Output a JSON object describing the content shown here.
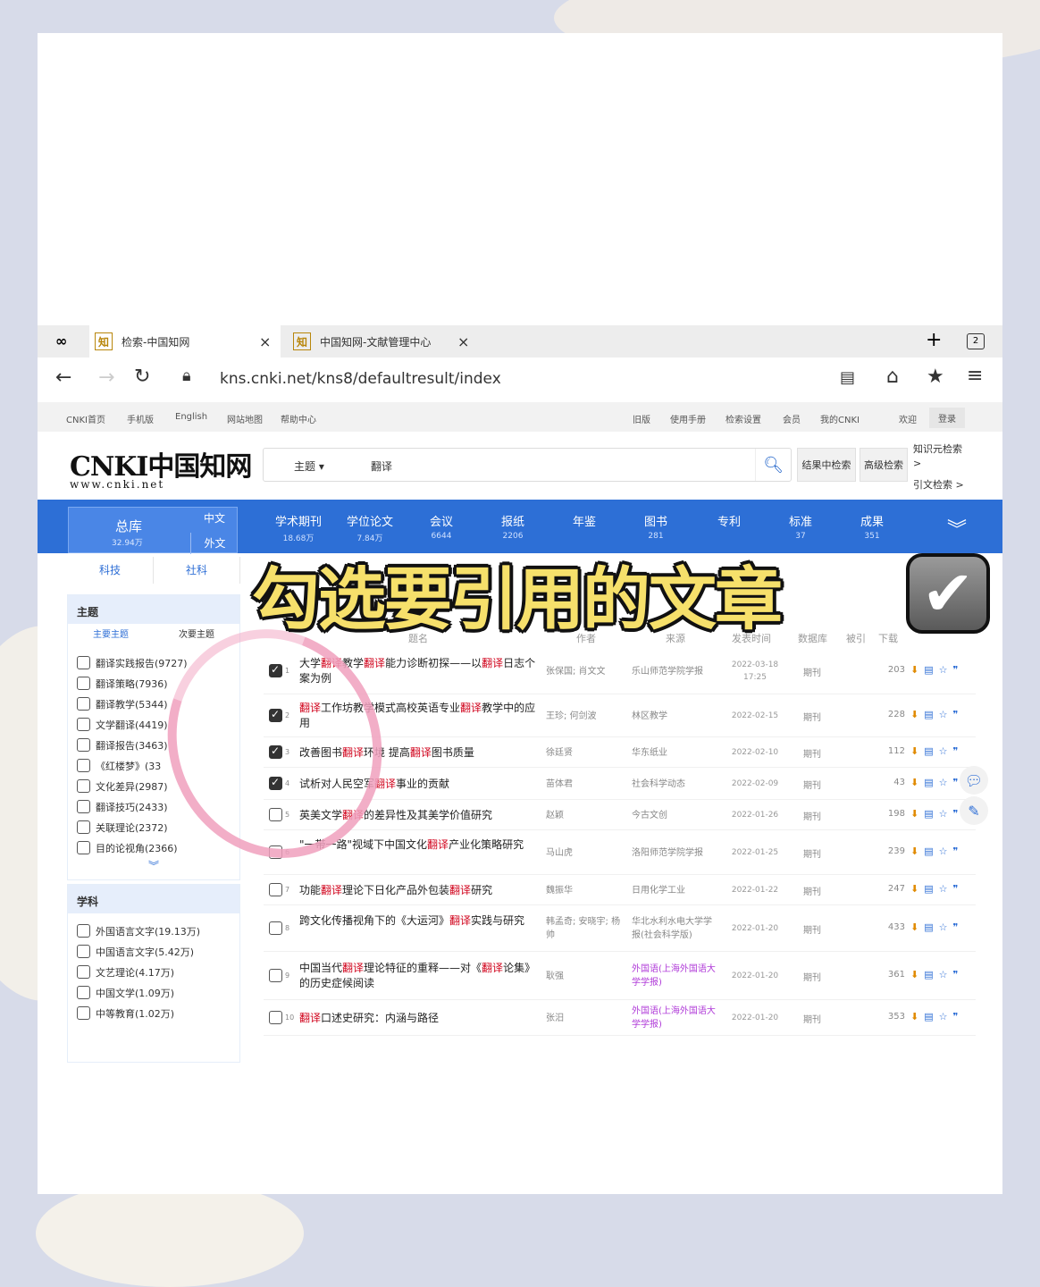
{
  "browser": {
    "tabs": [
      {
        "favicon": "知",
        "title": "检索-中国知网"
      },
      {
        "favicon": "知",
        "title": "中国知网-文献管理中心"
      }
    ],
    "tab_count": "2",
    "url": "kns.cnki.net/kns8/defaultresult/index"
  },
  "topnav": {
    "left": [
      "CNKI首页",
      "手机版",
      "English",
      "网站地图",
      "帮助中心"
    ],
    "right": [
      "旧版",
      "使用手册",
      "检索设置",
      "会员",
      "我的CNKI",
      "欢迎",
      "登录"
    ]
  },
  "header": {
    "logo_main": "CNKI中国知网",
    "logo_sub": "www.cnki.net",
    "search_field": "主题",
    "search_keyword": "翻译",
    "btn_in_results": "结果中检索",
    "btn_advanced": "高级检索",
    "link_knowledge": "知识元检索 >",
    "link_citation": "引文检索 >"
  },
  "databases": {
    "zongku": {
      "name": "总库",
      "count": "32.94万",
      "zh": "中文",
      "wai": "外文"
    },
    "tabs": [
      {
        "name": "学术期刊",
        "count": "18.68万"
      },
      {
        "name": "学位论文",
        "count": "7.84万"
      },
      {
        "name": "会议",
        "count": "6644"
      },
      {
        "name": "报纸",
        "count": "2206"
      },
      {
        "name": "年鉴",
        "count": ""
      },
      {
        "name": "图书",
        "count": "281"
      },
      {
        "name": "专利",
        "count": ""
      },
      {
        "name": "标准",
        "count": "37"
      },
      {
        "name": "成果",
        "count": "351"
      }
    ]
  },
  "left": {
    "subtabs": [
      "科技",
      "社科"
    ],
    "topic": {
      "title": "主题",
      "sub": [
        "主要主题",
        "次要主题"
      ],
      "items": [
        "翻译实践报告(9727)",
        "翻译策略(7936)",
        "翻译教学(5344)",
        "文学翻译(4419)",
        "翻译报告(3463)",
        "《红楼梦》(33",
        "文化差异(2987)",
        "翻译技巧(2433)",
        "关联理论(2372)",
        "目的论视角(2366)"
      ]
    },
    "subject": {
      "title": "学科",
      "items": [
        "外国语言文字(19.13万)",
        "中国语言文字(5.42万)",
        "文艺理论(4.17万)",
        "中国文学(1.09万)",
        "中等教育(1.02万)"
      ]
    }
  },
  "table": {
    "headers": [
      "题名",
      "作者",
      "来源",
      "发表时间",
      "数据库",
      "被引",
      "下载"
    ],
    "rows": [
      {
        "num": "1",
        "checked": true,
        "title_parts": [
          "大学",
          "翻译",
          "教学",
          "翻译",
          "能力诊断初探——以",
          "翻译",
          "日志个案为例"
        ],
        "author": "张保国; 肖文文",
        "source": "乐山师范学院学报",
        "date": "2022-03-18 17:25",
        "db": "期刊",
        "downloads": "203"
      },
      {
        "num": "2",
        "checked": true,
        "title_parts": [
          "",
          "翻译",
          "工作坊教学模式",
          "",
          "高校英语专业",
          "翻译",
          "教学中的应用"
        ],
        "author": "王珍; 何剑波",
        "source": "林区教学",
        "date": "2022-02-15",
        "db": "期刊",
        "downloads": "228"
      },
      {
        "num": "3",
        "checked": true,
        "title_parts": [
          "改善图书",
          "翻译",
          "环境 提高",
          "翻译",
          "图书质量",
          "",
          ""
        ],
        "author": "徐廷贤",
        "source": "华东纸业",
        "date": "2022-02-10",
        "db": "期刊",
        "downloads": "112"
      },
      {
        "num": "4",
        "checked": true,
        "title_parts": [
          "试析",
          "",
          "对人民空军",
          "翻译",
          "事业的贡献",
          "",
          ""
        ],
        "author": "苗体君",
        "source": "社会科学动态",
        "date": "2022-02-09",
        "db": "期刊",
        "downloads": "43"
      },
      {
        "num": "5",
        "checked": false,
        "title_parts": [
          "英美文学",
          "翻译",
          "的差异性及其美学价值研究",
          "",
          "",
          "",
          ""
        ],
        "author": "赵颖",
        "source": "今古文创",
        "date": "2022-01-26",
        "db": "期刊",
        "downloads": "198"
      },
      {
        "num": "6",
        "checked": false,
        "title_parts": [
          "\"一带一路\"视域下中国文化",
          "翻译",
          "产业化策略研究",
          "",
          "",
          "",
          ""
        ],
        "author": "马山虎",
        "source": "洛阳师范学院学报",
        "date": "2022-01-25",
        "db": "期刊",
        "downloads": "239"
      },
      {
        "num": "7",
        "checked": false,
        "title_parts": [
          "功能",
          "翻译",
          "理论下日化产品外包装",
          "翻译",
          "研究",
          "",
          ""
        ],
        "author": "魏振华",
        "source": "日用化学工业",
        "date": "2022-01-22",
        "db": "期刊",
        "downloads": "247"
      },
      {
        "num": "8",
        "checked": false,
        "title_parts": [
          "跨文化传播视角下的《大运河》",
          "翻译",
          "实践与研究",
          "",
          "",
          "",
          ""
        ],
        "author": "韩孟奇; 安晓宇; 杨帅",
        "source": "华北水利水电大学学报(社会科学版)",
        "date": "2022-01-20",
        "db": "期刊",
        "downloads": "433"
      },
      {
        "num": "9",
        "checked": false,
        "title_parts": [
          "中国当代",
          "翻译",
          "理论特征的重释——对《",
          "翻译",
          "论集》的历史症候阅读",
          "",
          ""
        ],
        "author": "耿强",
        "source": "外国语(上海外国语大学学报)",
        "date": "2022-01-20",
        "db": "期刊",
        "downloads": "361"
      },
      {
        "num": "10",
        "checked": false,
        "title_parts": [
          "",
          "翻译",
          "口述史研究：内涵与路径",
          "",
          "",
          "",
          ""
        ],
        "author": "张汨",
        "source": "外国语(上海外国语大学学报)",
        "date": "2022-01-20",
        "db": "期刊",
        "downloads": "353"
      }
    ]
  },
  "overlay": {
    "caption": "勾选要引用的文章"
  }
}
